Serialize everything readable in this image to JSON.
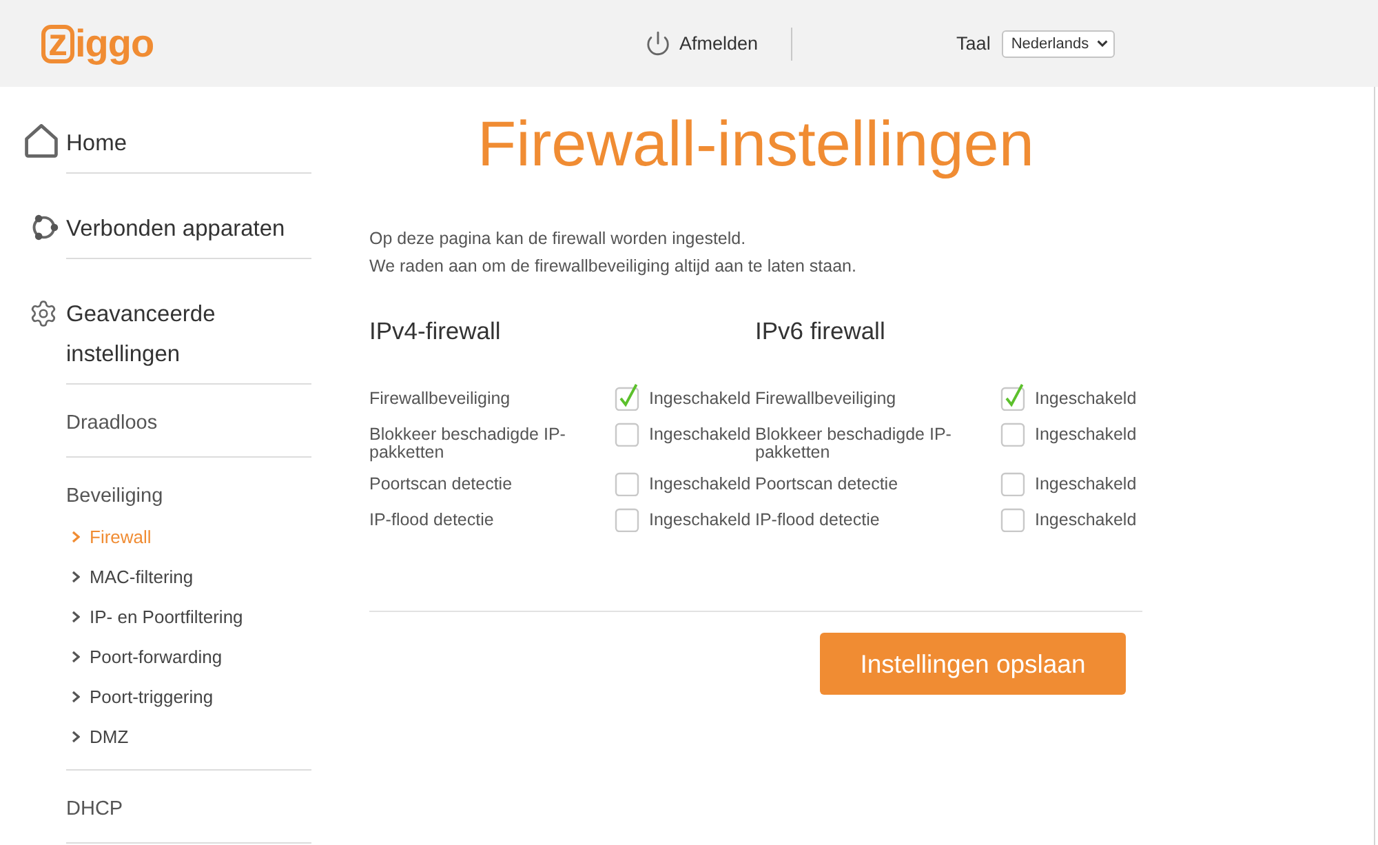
{
  "header": {
    "logo": "ziggo",
    "logout_button": "Afmelden",
    "language": {
      "label": "Taal",
      "value": "Nederlands"
    }
  },
  "sidebar": {
    "items": [
      {
        "label": "Home"
      },
      {
        "label": "Verbonden apparaten"
      },
      {
        "label": "Geavanceerde instellingen",
        "children": [
          {
            "label": "Draadloos"
          },
          {
            "label": "Beveiliging",
            "children": [
              {
                "label": "Firewall",
                "selected": true
              },
              {
                "label": "MAC-filtering",
                "selected": false
              },
              {
                "label": "IP- en Poortfiltering",
                "selected": false
              },
              {
                "label": "Poort-forwarding",
                "selected": false
              },
              {
                "label": "Poort-triggering",
                "selected": false
              },
              {
                "label": "DMZ",
                "selected": false
              }
            ]
          },
          {
            "label": "DHCP"
          }
        ]
      }
    ]
  },
  "page": {
    "title": "Firewall-instellingen",
    "intro": [
      "Op deze pagina kan de firewall worden ingesteld.",
      "We raden aan om de firewallbeveiliging altijd aan te laten staan."
    ],
    "firewalls": [
      {
        "title": "IPv4-firewall",
        "rows": [
          {
            "label": "Firewallbeveiliging",
            "checked": true,
            "option": "Ingeschakeld"
          },
          {
            "label": "Blokkeer beschadigde IP-pakketten",
            "checked": false,
            "option": "Ingeschakeld"
          },
          {
            "label": "Poortscan detectie",
            "checked": false,
            "option": "Ingeschakeld"
          },
          {
            "label": "IP-flood detectie",
            "checked": false,
            "option": "Ingeschakeld"
          }
        ]
      },
      {
        "title": "IPv6 firewall",
        "rows": [
          {
            "label": "Firewallbeveiliging",
            "checked": true,
            "option": "Ingeschakeld"
          },
          {
            "label": "Blokkeer beschadigde IP-pakketten",
            "checked": false,
            "option": "Ingeschakeld"
          },
          {
            "label": "Poortscan detectie",
            "checked": false,
            "option": "Ingeschakeld"
          },
          {
            "label": "IP-flood detectie",
            "checked": false,
            "option": "Ingeschakeld"
          }
        ]
      }
    ],
    "save_button": "Instellingen opslaan"
  }
}
